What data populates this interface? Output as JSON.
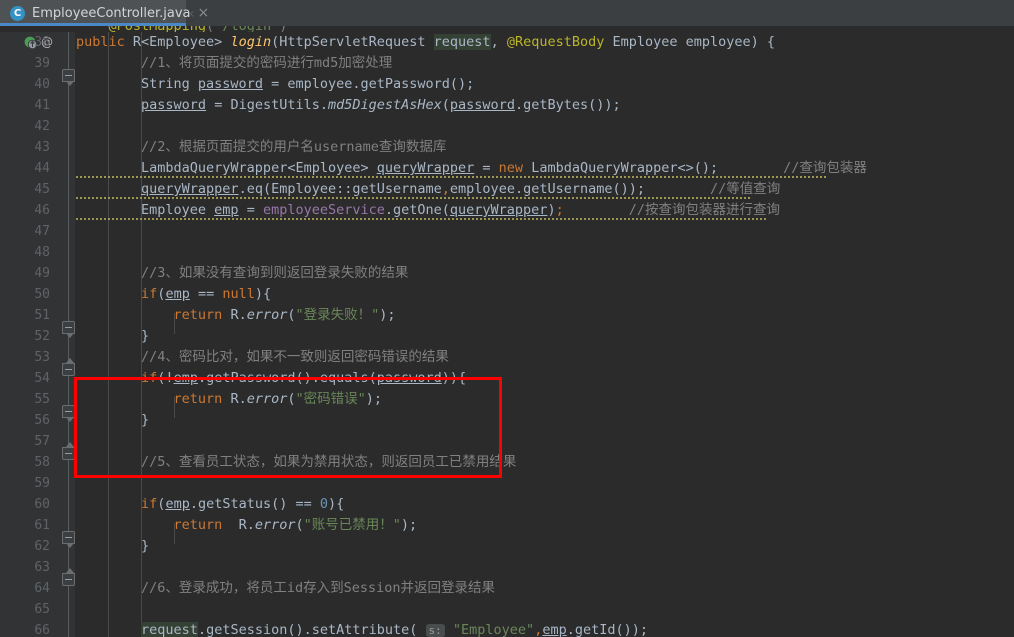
{
  "window": {
    "app": "IntelliJ IDEA editor",
    "theme_bg": "#2b2b2b",
    "gutter_bg": "#313335",
    "accent": "#4a88c7",
    "annotation_color": "#fe0000"
  },
  "tabbar": {
    "active_tab": {
      "label": "EmployeeController.java",
      "icon": "java-class-icon",
      "icon_letter": "C",
      "close_label": "×"
    },
    "overflow_arrow": "‹"
  },
  "gutter": {
    "override_icon": "method-override-icon",
    "annotation_marker": "@"
  },
  "editor": {
    "first_visible_line": 38,
    "last_visible_line": 66,
    "lines": [
      {
        "no": 38,
        "text": "    public R<Employee> login(HttpServletRequest request, @RequestBody Employee employee) {"
      },
      {
        "no": 39,
        "text": "        //1、将页面提交的密码进行md5加密处理"
      },
      {
        "no": 40,
        "text": "        String password = employee.getPassword();"
      },
      {
        "no": 41,
        "text": "        password = DigestUtils.md5DigestAsHex(password.getBytes());"
      },
      {
        "no": 42,
        "text": ""
      },
      {
        "no": 43,
        "text": "        //2、根据页面提交的用户名username查询数据库"
      },
      {
        "no": 44,
        "text": "        LambdaQueryWrapper<Employee> queryWrapper = new LambdaQueryWrapper<>();        //查询包装器"
      },
      {
        "no": 45,
        "text": "        queryWrapper.eq(Employee::getUsername,employee.getUsername());        //等值查询"
      },
      {
        "no": 46,
        "text": "        Employee emp = employeeService.getOne(queryWrapper);        //按查询包装器进行查询"
      },
      {
        "no": 47,
        "text": ""
      },
      {
        "no": 48,
        "text": ""
      },
      {
        "no": 49,
        "text": "        //3、如果没有查询到则返回登录失败的结果"
      },
      {
        "no": 50,
        "text": "        if(emp == null){"
      },
      {
        "no": 51,
        "text": "            return R.error(\"登录失败！\");"
      },
      {
        "no": 52,
        "text": "        }"
      },
      {
        "no": 53,
        "text": "        //4、密码比对，如果不一致则返回密码错误的结果"
      },
      {
        "no": 54,
        "text": "        if(!emp.getPassword().equals(password)){"
      },
      {
        "no": 55,
        "text": "            return R.error(\"密码错误\");"
      },
      {
        "no": 56,
        "text": "        }"
      },
      {
        "no": 57,
        "text": ""
      },
      {
        "no": 58,
        "text": "        //5、查看员工状态，如果为禁用状态，则返回员工已禁用结果"
      },
      {
        "no": 59,
        "text": ""
      },
      {
        "no": 60,
        "text": "        if(emp.getStatus() == 0){"
      },
      {
        "no": 61,
        "text": "            return  R.error(\"账号已禁用！\");"
      },
      {
        "no": 62,
        "text": "        }"
      },
      {
        "no": 63,
        "text": ""
      },
      {
        "no": 64,
        "text": "        //6、登录成功，将员工id存入到Session并返回登录结果"
      },
      {
        "no": 65,
        "text": ""
      },
      {
        "no": 66,
        "text": "        request.getSession().setAttribute( s: \"Employee\",emp.getId());"
      }
    ],
    "tokens": {
      "l38": [
        "public",
        "R<Employee>",
        "login",
        "HttpServletRequest",
        "request",
        "@RequestBody",
        "Employee",
        "employee"
      ],
      "l40": [
        "String",
        "password",
        "employee.getPassword()"
      ],
      "l41": [
        "password",
        "DigestUtils",
        "md5DigestAsHex",
        "password.getBytes()"
      ],
      "l44": [
        "LambdaQueryWrapper<Employee>",
        "queryWrapper",
        "new",
        "LambdaQueryWrapper<>()"
      ],
      "l45": [
        "queryWrapper.eq",
        "Employee::getUsername",
        "employee.getUsername()"
      ],
      "l46": [
        "Employee",
        "emp",
        "employeeService",
        "getOne",
        "queryWrapper"
      ],
      "l50": [
        "if",
        "emp",
        "null"
      ],
      "l51": [
        "return",
        "R.error",
        "登录失败！"
      ],
      "l54": [
        "if",
        "emp.getPassword().equals",
        "password"
      ],
      "l55": [
        "return",
        "R.error",
        "密码错误"
      ],
      "l60": [
        "if",
        "emp.getStatus()",
        "0"
      ],
      "l61": [
        "return",
        "R.error",
        "账号已禁用！"
      ],
      "l66": [
        "request.getSession().setAttribute",
        "s:",
        "Employee",
        "emp.getId()"
      ]
    },
    "parameter_hint": "s:",
    "highlighted_symbol": "request"
  },
  "annotation": {
    "shape": "rectangle",
    "color": "#fe0000",
    "covers_lines": [
      53,
      54,
      55,
      56
    ]
  }
}
